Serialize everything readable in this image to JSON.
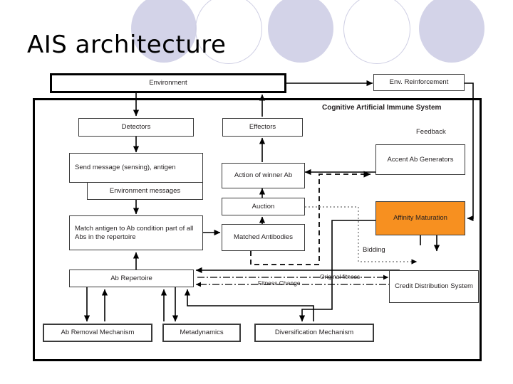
{
  "slide": {
    "title": "AIS architecture",
    "background_color": "#ffffff",
    "decor_color": "#d3d3e8",
    "accent_color": "#f79020"
  },
  "diagram": {
    "frame_label": "Cognitive Artificial Immune System",
    "boxes": {
      "environment": "Environment",
      "env_reinforcement": "Env. Reinforcement",
      "detectors": "Detectors",
      "effectors": "Effectors",
      "send_message": "Send message (sensing), antigen",
      "environment_messages": "Environment messages",
      "action_of_winner_ab": "Action of winner Ab",
      "auction": "Auction",
      "accent_ab_generators": "Accent Ab Generators",
      "affinity_maturation": "Affinity Maturation",
      "match_antigen": "Match antigen to Ab condition part of all Abs in the repertoire",
      "matched_antibodies": "Matched Antibodies",
      "ab_repertoire": "Ab Repertoire",
      "credit_distribution_system": "Credit Distribution System",
      "ab_removal_mechanism": "Ab Removal Mechanism",
      "metadynamics": "Metadynamics",
      "diversification_mechanism": "Diversification Mechanism"
    },
    "edge_labels": {
      "feedback": "Feedback",
      "bidding": "Bidding",
      "original_fitness": "Original fitness",
      "fitness_change": "Fitness Change"
    }
  }
}
